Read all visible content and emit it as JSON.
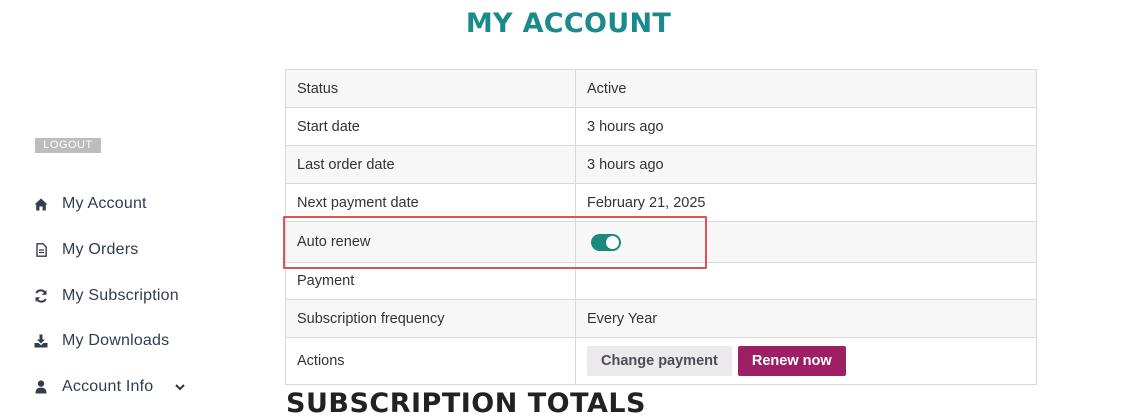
{
  "page": {
    "title": "MY ACCOUNT"
  },
  "sidebar": {
    "logout_label": "LOGOUT",
    "items": [
      {
        "label": "My Account",
        "icon": "home-icon"
      },
      {
        "label": "My Orders",
        "icon": "document-icon"
      },
      {
        "label": "My Subscription",
        "icon": "refresh-icon"
      },
      {
        "label": "My Downloads",
        "icon": "download-icon"
      },
      {
        "label": "Account Info",
        "icon": "user-icon",
        "has_dropdown": true
      }
    ]
  },
  "subscription": {
    "rows": [
      {
        "key": "Status",
        "value": "Active"
      },
      {
        "key": "Start date",
        "value": "3 hours ago"
      },
      {
        "key": "Last order date",
        "value": "3 hours ago"
      },
      {
        "key": "Next payment date",
        "value": "February 21, 2025"
      },
      {
        "key": "Auto renew",
        "toggle_on": true
      },
      {
        "key": "Payment",
        "value": ""
      },
      {
        "key": "Subscription frequency",
        "value": "Every Year"
      },
      {
        "key": "Actions"
      }
    ],
    "actions": {
      "change_payment_label": "Change payment",
      "renew_now_label": "Renew now"
    }
  },
  "totals": {
    "title": "SUBSCRIPTION TOTALS"
  },
  "colors": {
    "accent": "#1b8a8a",
    "toggle_on": "#1b8a7e",
    "renew_button": "#9e1f63",
    "highlight": "#e05353"
  }
}
